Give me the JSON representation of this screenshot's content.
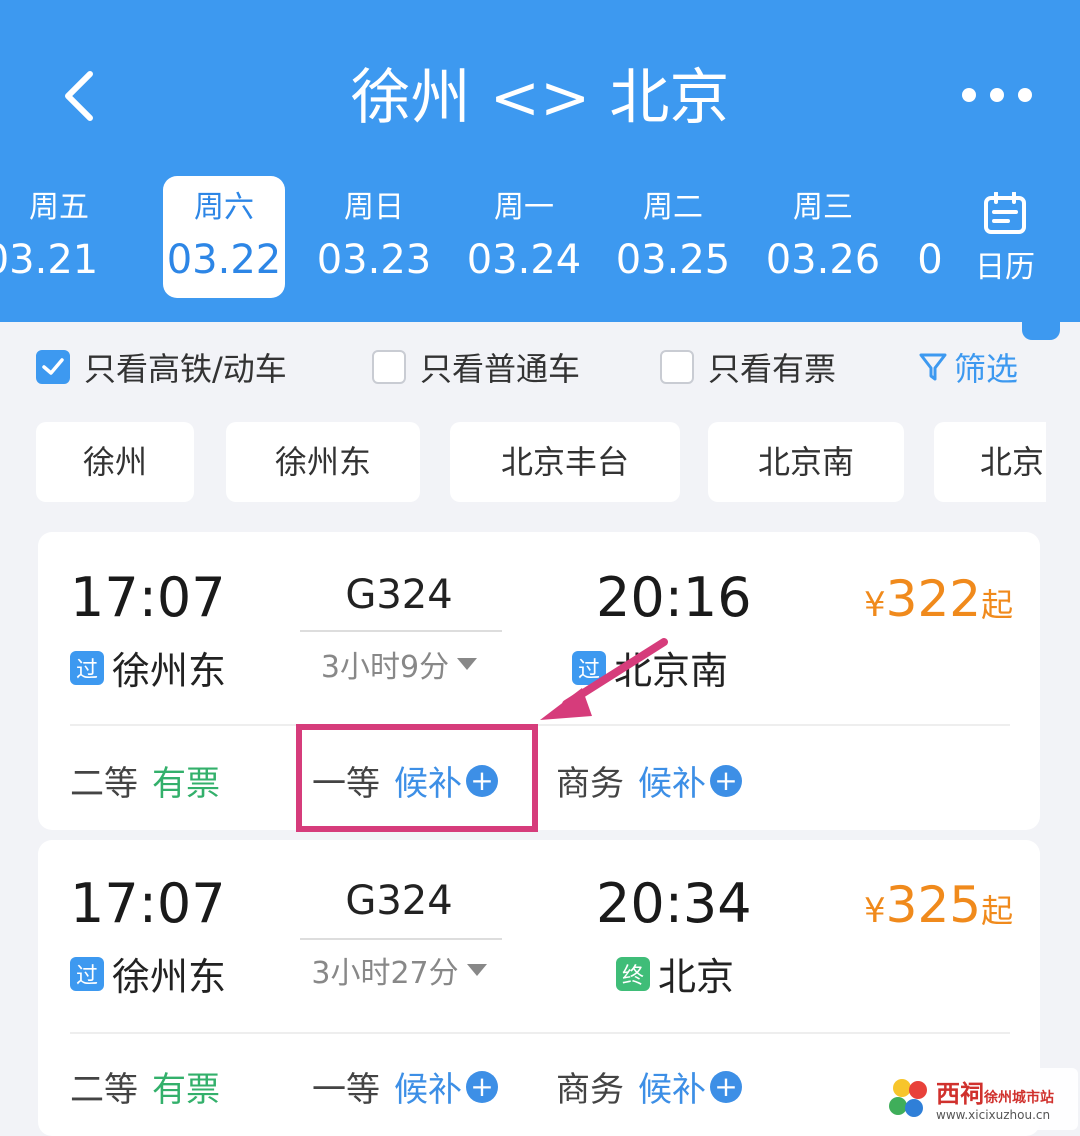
{
  "header": {
    "title": "徐州 <> 北京",
    "calendar_label": "日历"
  },
  "dates": [
    {
      "weekday": "周五",
      "date": "03.21"
    },
    {
      "weekday": "周六",
      "date": "03.22"
    },
    {
      "weekday": "周日",
      "date": "03.23"
    },
    {
      "weekday": "周一",
      "date": "03.24"
    },
    {
      "weekday": "周二",
      "date": "03.25"
    },
    {
      "weekday": "周三",
      "date": "03.26"
    },
    {
      "weekday": "",
      "date": "0"
    }
  ],
  "filters": {
    "high_speed": "只看高铁/动车",
    "regular": "只看普通车",
    "available": "只看有票",
    "filter_btn": "筛选"
  },
  "stations": [
    "徐州",
    "徐州东",
    "北京丰台",
    "北京南",
    "北京"
  ],
  "trains": [
    {
      "depart_time": "17:07",
      "train_no": "G324",
      "duration": "3小时9分",
      "arrive_time": "20:16",
      "from_tag": "过",
      "from_station": "徐州东",
      "to_tag": "过",
      "to_station": "北京南",
      "price_symbol": "¥",
      "price": "322",
      "price_suffix": "起",
      "seats": [
        {
          "class": "二等",
          "status": "有票"
        },
        {
          "class": "一等",
          "status": "候补"
        },
        {
          "class": "商务",
          "status": "候补"
        }
      ]
    },
    {
      "depart_time": "17:07",
      "train_no": "G324",
      "duration": "3小时27分",
      "arrive_time": "20:34",
      "from_tag": "过",
      "from_station": "徐州东",
      "to_tag": "终",
      "to_station": "北京",
      "price_symbol": "¥",
      "price": "325",
      "price_suffix": "起",
      "seats": [
        {
          "class": "二等",
          "status": "有票"
        },
        {
          "class": "一等",
          "status": "候补"
        },
        {
          "class": "商务",
          "status": "候补"
        }
      ]
    }
  ],
  "watermark": {
    "brand": "西祠",
    "city": "徐州城市站",
    "url": "www.xicixuzhou.cn"
  },
  "colors": {
    "header_blue": "#3d99f0",
    "price_orange": "#f08a1c",
    "available_green": "#33b06b",
    "waitlist_blue": "#3d8fe6",
    "highlight_pink": "#d63c7b"
  }
}
